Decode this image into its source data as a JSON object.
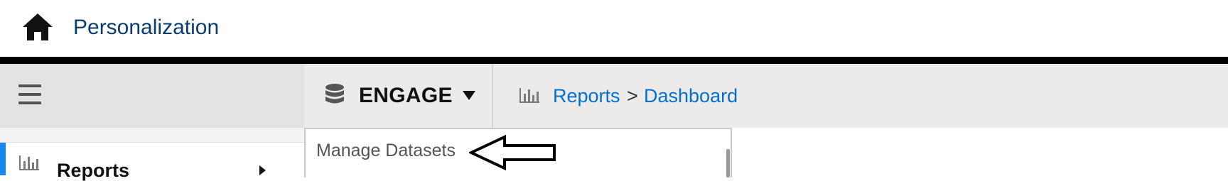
{
  "header": {
    "title": "Personalization",
    "home_icon": "home-icon"
  },
  "navbar": {
    "menu_icon": "hamburger-icon",
    "dataset_switcher": {
      "icon": "database-icon",
      "label": "ENGAGE",
      "caret_icon": "caret-down-icon"
    },
    "breadcrumb": {
      "icon": "bar-chart-icon",
      "items": [
        "Reports",
        "Dashboard"
      ],
      "separator": ">"
    }
  },
  "sidebar": {
    "items": [
      {
        "label": "Reports",
        "icon": "bar-chart-icon",
        "active": true
      }
    ]
  },
  "dropdown": {
    "items": [
      "Manage Datasets"
    ]
  },
  "annotation": {
    "icon": "left-arrow-outline-icon"
  },
  "colors": {
    "link": "#0070d2",
    "title": "#0b3c6e",
    "navbar_bg": "#ecebea",
    "accent": "#1589ee"
  }
}
